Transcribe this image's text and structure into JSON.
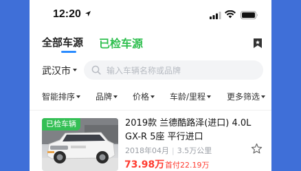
{
  "status_bar": {
    "time": "12:20"
  },
  "tabs": [
    {
      "label": "全部车源",
      "active": true
    },
    {
      "label": "已检车源",
      "active": false
    }
  ],
  "search": {
    "city": "武汉市",
    "placeholder": "输入车辆名称或品牌"
  },
  "filters": [
    {
      "label": "智能排序"
    },
    {
      "label": "品牌"
    },
    {
      "label": "价格"
    },
    {
      "label": "车龄/里程"
    },
    {
      "label": "更多筛选"
    }
  ],
  "listing": {
    "badge": "已检车辆",
    "title": "2019款 兰德酷路泽(进口) 4.0L GX-R 5座 平行进口",
    "year": "2018年04月",
    "mileage": "3.5万公里",
    "price": "73.98万",
    "down_payment": "首付22.19万"
  },
  "colors": {
    "background": "#3f6fd8",
    "accent_blue": "#2a8bff",
    "accent_green": "#2fbf4f",
    "price_red": "#ff3b2f"
  }
}
